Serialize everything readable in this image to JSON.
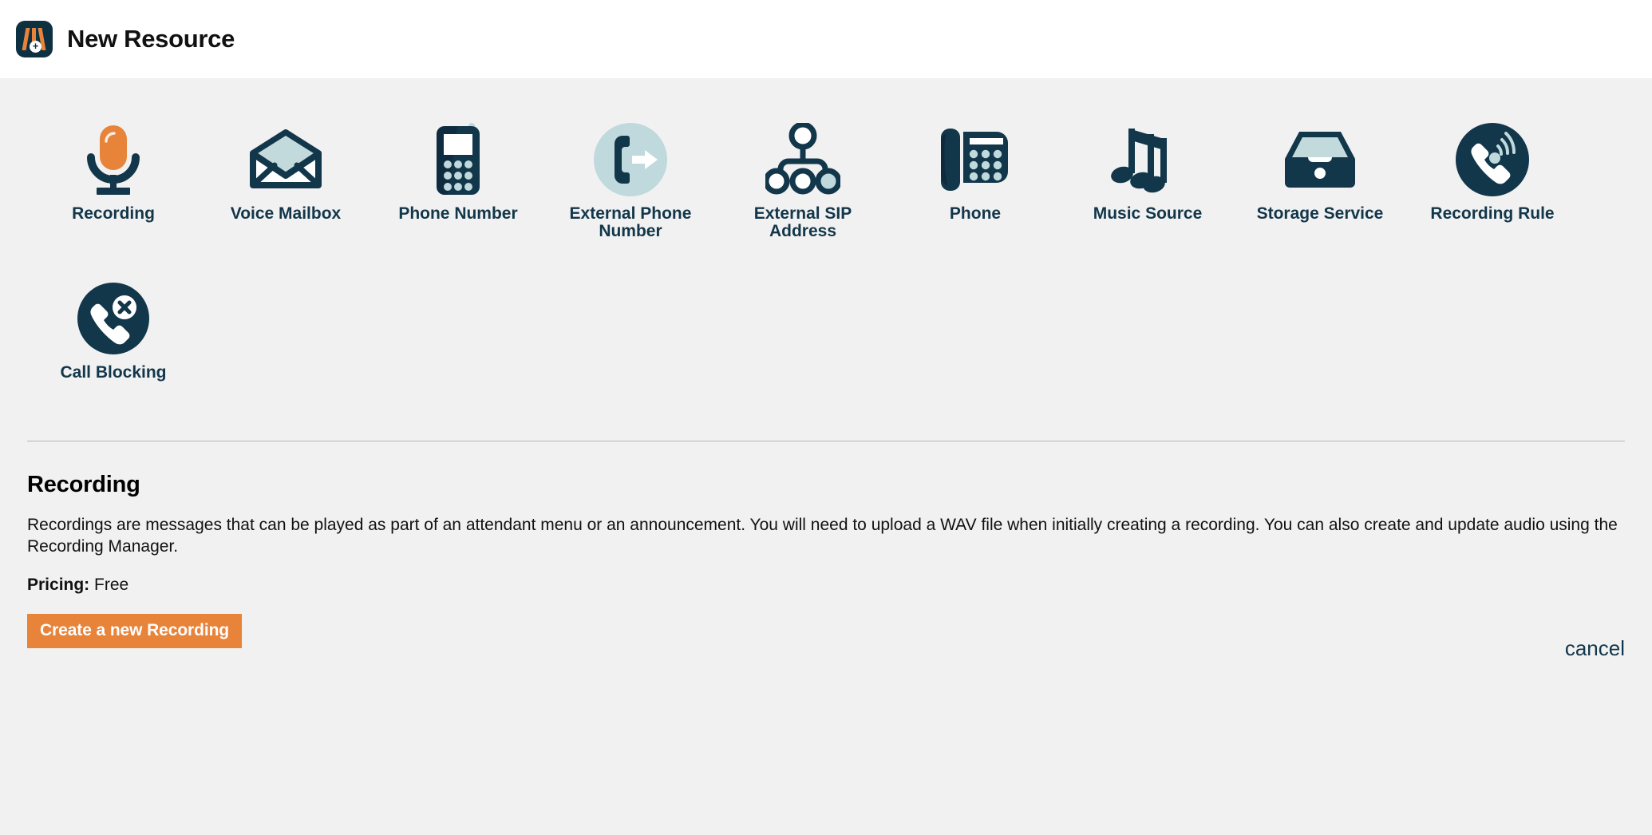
{
  "header": {
    "title": "New Resource",
    "logo_icon": "new-resource-logo-icon",
    "logo_plus": "+"
  },
  "colors": {
    "navy": "#12364a",
    "dark_navy": "#0e3142",
    "orange": "#e8833a",
    "light_blue": "#bfd9dc",
    "page_background": "#f1f1f1",
    "header_background": "#ffffff",
    "divider": "#b6b6b6"
  },
  "resources": [
    {
      "label": "Recording",
      "icon": "microphone-icon"
    },
    {
      "label": "Voice Mailbox",
      "icon": "open-envelope-icon"
    },
    {
      "label": "Phone Number",
      "icon": "mobile-phone-icon"
    },
    {
      "label": "External Phone Number",
      "icon": "phone-forward-icon"
    },
    {
      "label": "External SIP Address",
      "icon": "sip-tree-icon"
    },
    {
      "label": "Phone",
      "icon": "desk-phone-icon"
    },
    {
      "label": "Music Source",
      "icon": "music-notes-icon"
    },
    {
      "label": "Storage Service",
      "icon": "inbox-tray-icon"
    },
    {
      "label": "Recording Rule",
      "icon": "phone-signal-circle-icon"
    },
    {
      "label": "Call Blocking",
      "icon": "phone-blocked-circle-icon"
    }
  ],
  "detail": {
    "title": "Recording",
    "description": "Recordings are messages that can be played as part of an attendant menu or an announcement. You will need to upload a WAV file when initially creating a recording. You can also create and update audio using the Recording Manager.",
    "pricing_label": "Pricing:",
    "pricing_value": "Free",
    "primary_button": "Create a new Recording",
    "cancel_link": "cancel"
  }
}
